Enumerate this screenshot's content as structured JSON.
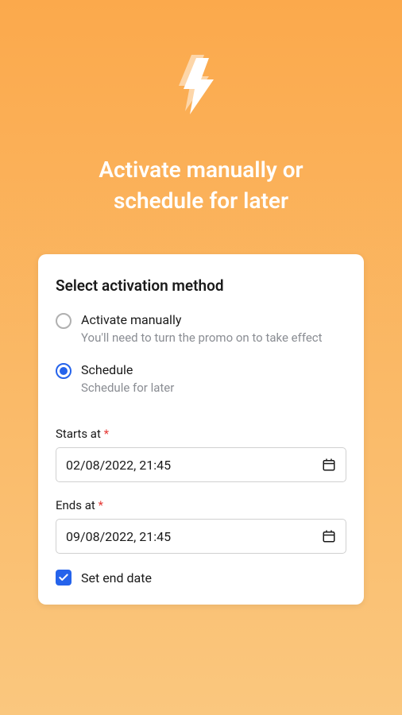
{
  "hero": {
    "title_line1": "Activate manually or",
    "title_line2": "schedule for later"
  },
  "card": {
    "title": "Select activation method",
    "options": [
      {
        "label": "Activate manually",
        "description": "You'll need to turn the promo on to take effect",
        "selected": false
      },
      {
        "label": "Schedule",
        "description": "Schedule for later",
        "selected": true
      }
    ],
    "starts_at": {
      "label": "Starts at",
      "value": "02/08/2022, 21:45"
    },
    "ends_at": {
      "label": "Ends at",
      "value": "09/08/2022, 21:45"
    },
    "set_end_date": {
      "label": "Set end date",
      "checked": true
    }
  }
}
